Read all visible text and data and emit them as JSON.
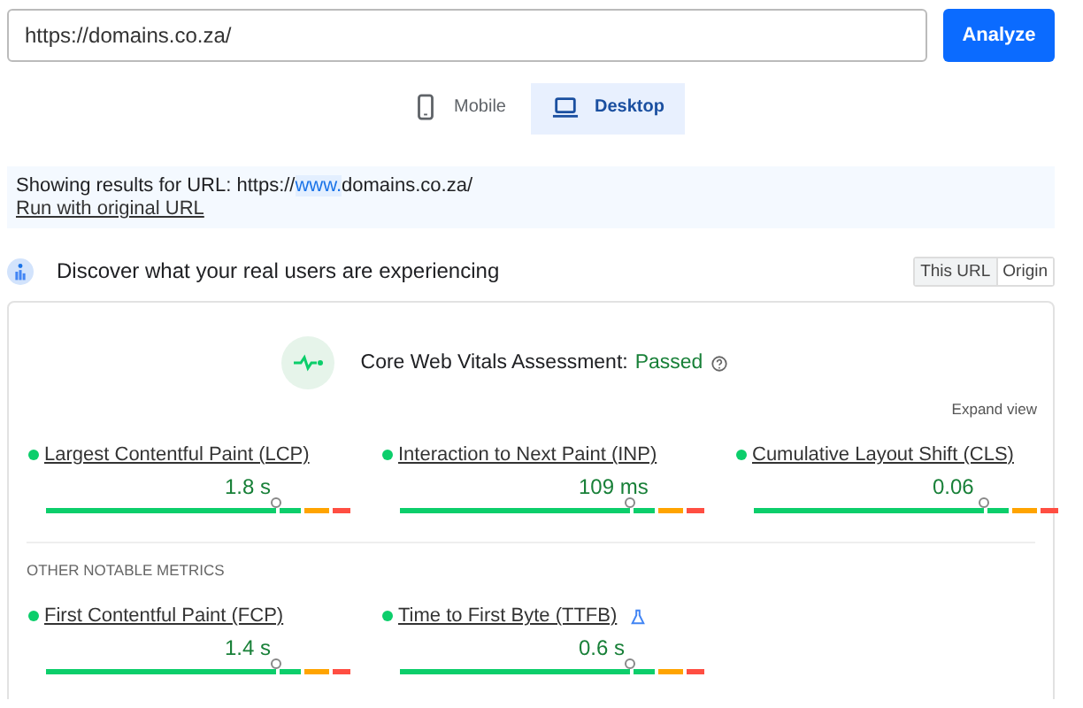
{
  "url_field": {
    "value": "https://domains.co.za/"
  },
  "analyze_button": {
    "label": "Analyze"
  },
  "device_tabs": [
    {
      "label": "Mobile",
      "kind": "phone",
      "selected": false
    },
    {
      "label": "Desktop",
      "kind": "laptop",
      "selected": true
    }
  ],
  "notice": {
    "text": "Showing results for URL: https://",
    "highlight": "www.",
    "text_end": "domains.co.za/",
    "link": "Run with original URL"
  },
  "field_data": {
    "title": "Discover what your real users are experiencing",
    "scope_toggle": [
      {
        "label": "This URL",
        "selected": true
      },
      {
        "label": "Origin",
        "selected": false
      }
    ]
  },
  "assessment": {
    "label": "Core Web Vitals Assessment:",
    "result": "Passed",
    "passed": true,
    "expand": "Expand view"
  },
  "core_metrics": [
    {
      "name": "Largest Contentful Paint (LCP)",
      "value": "1.8 s",
      "level": 0.74,
      "experimental": false
    },
    {
      "name": "Interaction to Next Paint (INP)",
      "value": "109 ms",
      "level": 0.74,
      "experimental": false
    },
    {
      "name": "Cumulative Layout Shift (CLS)",
      "value": "0.06",
      "level": 0.74,
      "experimental": false
    }
  ],
  "other_heading": "OTHER NOTABLE METRICS",
  "other_metrics": [
    {
      "name": "First Contentful Paint (FCP)",
      "value": "1.4 s",
      "level": 0.74,
      "experimental": false
    },
    {
      "name": "Time to First Byte (TTFB)",
      "value": "0.6 s",
      "level": 0.74,
      "experimental": true
    }
  ]
}
